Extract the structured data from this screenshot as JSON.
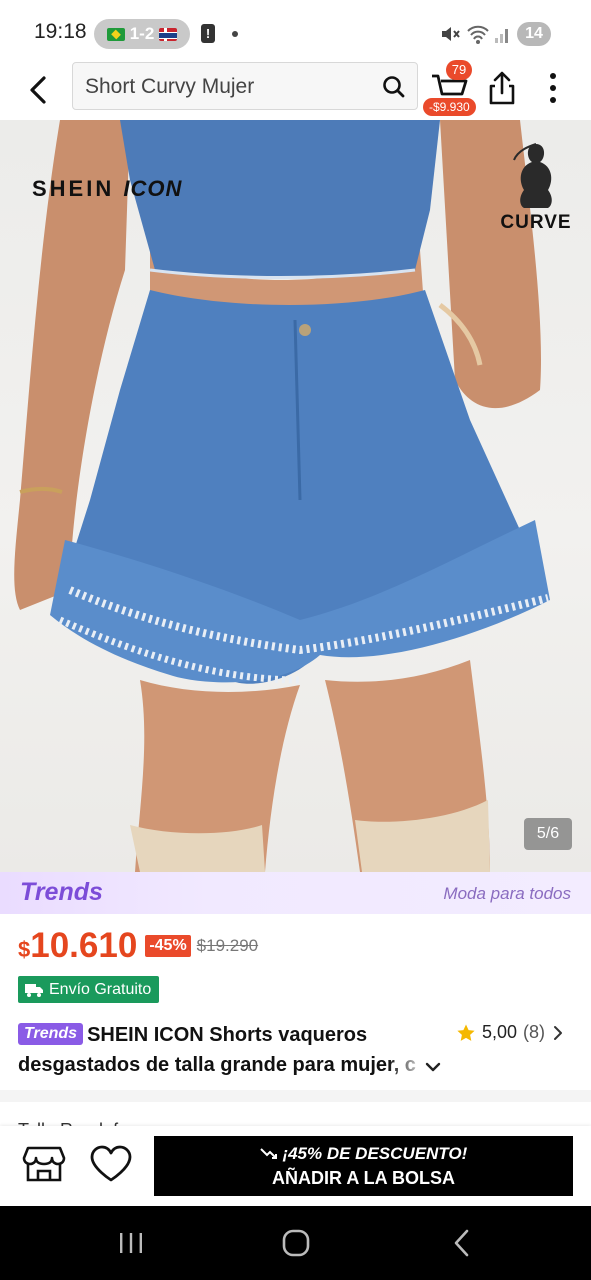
{
  "status_bar": {
    "time": "19:18",
    "network_pill": "1-2",
    "battery": "14"
  },
  "header": {
    "search_text": "Short Curvy Mujer",
    "cart_count": "79",
    "cart_price": "-$9.930",
    "icons": [
      "back-arrow-icon",
      "search-icon",
      "cart-icon",
      "share-icon",
      "more-vertical-icon"
    ]
  },
  "gallery": {
    "brand": "SHEIN",
    "brand_accent": "ICON",
    "badge_label": "CURVE",
    "counter": "5/6"
  },
  "trends_banner": {
    "logo": "Trends",
    "tagline": "Moda para todos"
  },
  "price": {
    "currency": "$",
    "current": "10.610",
    "discount": "-45%",
    "original": "$19.290",
    "accent_color": "#e5461e"
  },
  "shipping": {
    "label": "Envío Gratuito",
    "color": "#1a9a5c"
  },
  "product": {
    "tag": "Trends",
    "title": "SHEIN ICON Shorts vaqueros desgastados de talla grande para mujer, c",
    "rating": "5,00",
    "review_count": "(8)"
  },
  "size_row": {
    "label": "Talla Rendef..."
  },
  "action_bar": {
    "promo": "¡45% DE DESCUENTO!",
    "button_label": "AÑADIR A LA BOLSA"
  },
  "colors": {
    "discount_red": "#ea4a2b",
    "trends_purple": "#7c4dd8",
    "button_black": "#000000"
  }
}
